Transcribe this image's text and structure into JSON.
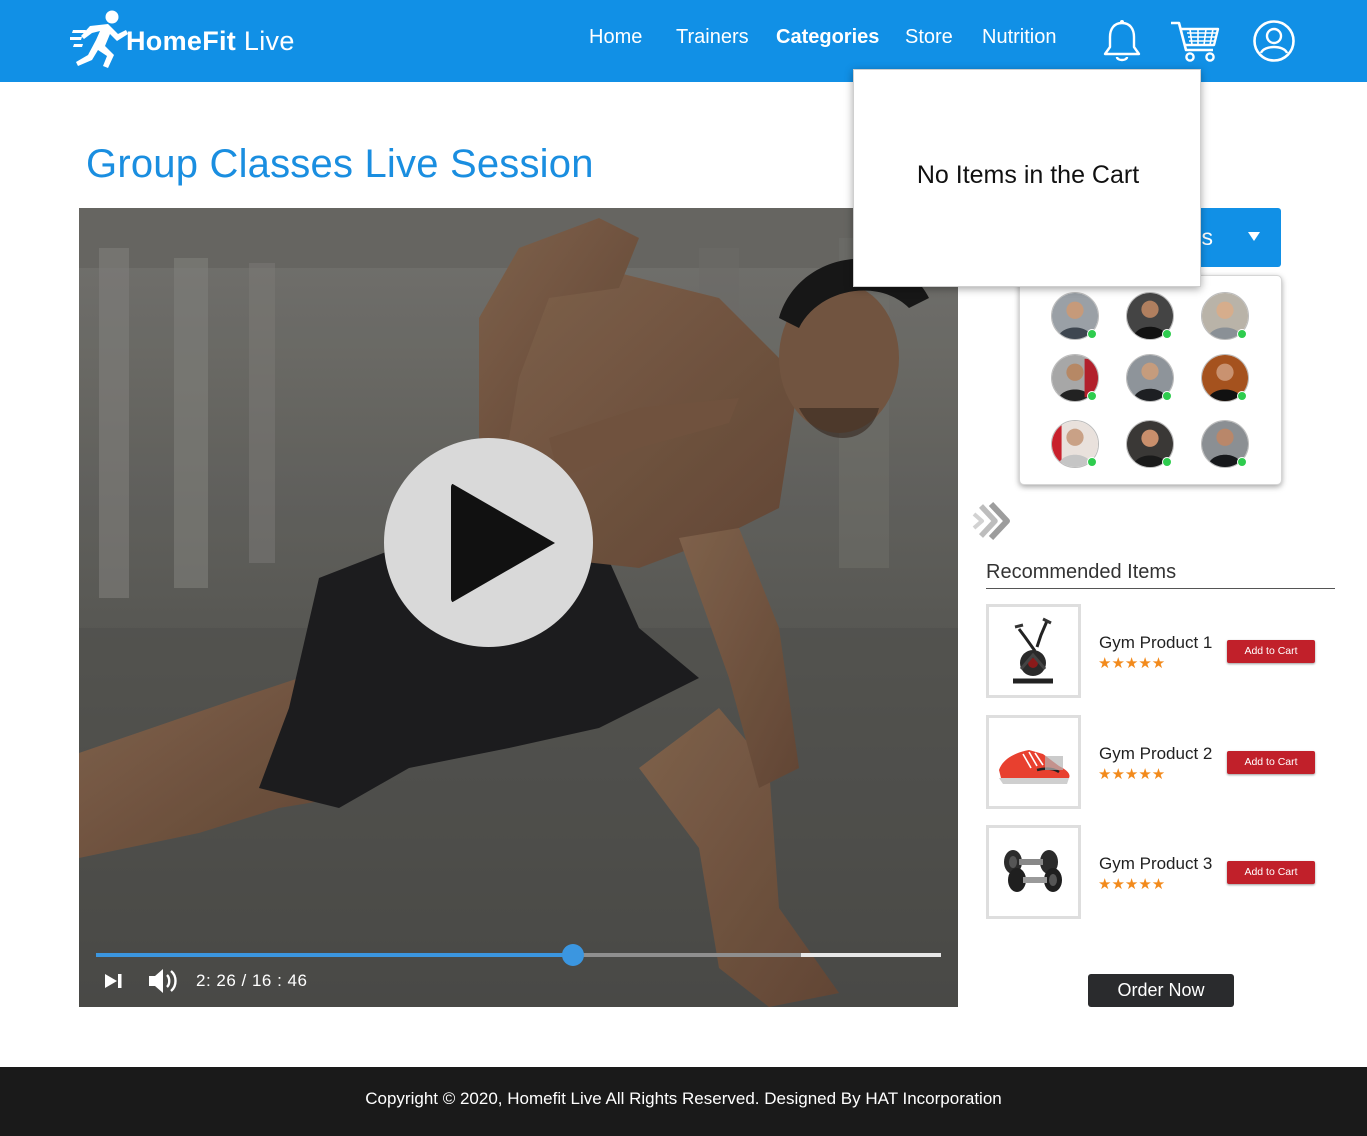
{
  "header": {
    "brand": "HomeFit",
    "brand_suffix": " Live",
    "nav": [
      {
        "label": "Home",
        "active": false
      },
      {
        "label": "Trainers",
        "active": false
      },
      {
        "label": "Categories",
        "active": true
      },
      {
        "label": "Store",
        "active": false
      },
      {
        "label": "Nutrition",
        "active": false
      }
    ],
    "icons": [
      "bell-icon",
      "cart-icon",
      "user-icon"
    ],
    "color": "#1190e6"
  },
  "page": {
    "title": "Group Classes Live Session"
  },
  "video": {
    "play_icon": "play-icon",
    "time_display": "2: 26 / 16 : 46",
    "progress": 0.565,
    "buffered": 0.834
  },
  "participants": {
    "label": "s",
    "count_visible": 9,
    "online_color": "#2ecc4e"
  },
  "recommended": {
    "title": "Recommended Items",
    "items": [
      {
        "name": "Gym Product 1",
        "stars": "★★★★★",
        "button": "Add to Cart",
        "icon": "elliptical-machine-icon"
      },
      {
        "name": "Gym Product 2",
        "stars": "★★★★★",
        "button": "Add to Cart",
        "icon": "running-shoe-icon"
      },
      {
        "name": "Gym Product 3",
        "stars": "★★★★★",
        "button": "Add to Cart",
        "icon": "dumbbells-icon"
      }
    ],
    "order_button": "Order Now"
  },
  "cart_popup": {
    "message": "No Items in the Cart"
  },
  "footer": {
    "copyright": "Copyright © 2020, Homefit Live All Rights Reserved. Designed By HAT Incorporation"
  }
}
